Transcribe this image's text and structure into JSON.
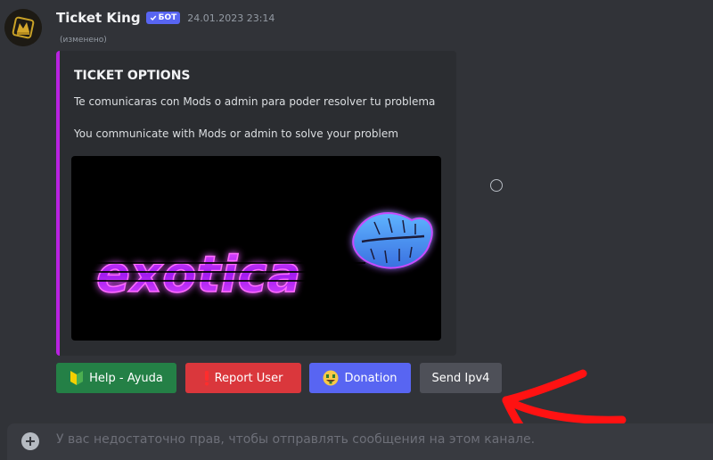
{
  "message": {
    "author": "Ticket King",
    "badge": "БОТ",
    "timestamp": "24.01.2023 23:14",
    "edited_label": "(изменено)"
  },
  "embed": {
    "accent_color": "#b822e0",
    "title": "TICKET OPTIONS",
    "description_lines": [
      "Te comunicaras con Mods o admin para poder resolver tu problema",
      "You communicate with Mods or admin to solve your problem"
    ],
    "image_text": "exotica"
  },
  "buttons": [
    {
      "label": "Help - Ayuda",
      "icon": "beginner-icon",
      "color": "#248046"
    },
    {
      "label": "Report User",
      "icon": "exclamation-icon",
      "color": "#da373c"
    },
    {
      "label": "Donation",
      "icon": "money-face-icon",
      "color": "#5865f2"
    },
    {
      "label": "Send Ipv4",
      "icon": "",
      "color": "#4e5058"
    }
  ],
  "composer": {
    "placeholder": "У вас недостаточно прав, чтобы отправлять сообщения на этом канале."
  }
}
